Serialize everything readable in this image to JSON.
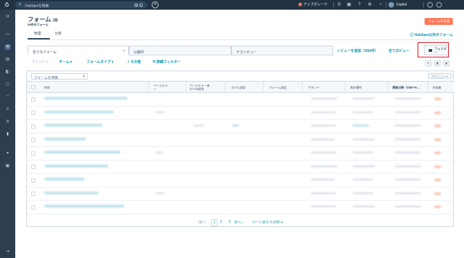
{
  "topbar": {
    "search_placeholder": "HubSpotを検索",
    "kbd1": "⌘",
    "kbd2": "K",
    "add_label": "+",
    "upgrade_label": "アップグレード",
    "copilot_label": "Copilot"
  },
  "page": {
    "title": "フォーム",
    "title_badge": "JB",
    "subtitle": "54件のフォーム",
    "create_button": "フォームを作成",
    "tabs": [
      {
        "label": "管理"
      },
      {
        "label": "分析"
      }
    ],
    "external_link": "HubSpot以外のフォーム"
  },
  "views": {
    "items": [
      {
        "label": "全てのフォーム"
      },
      {
        "label": "公開中"
      },
      {
        "label": "テストビュー"
      }
    ],
    "add_view": "ビューを追加（3/50件）",
    "all_views": "全てのビュー",
    "folder_button": "フォルダ\n―"
  },
  "filters": {
    "brand": "ブランド",
    "team": "チーム",
    "form_type": "フォームタイプ",
    "other": "その他",
    "advanced": "詳細フィルター"
  },
  "table": {
    "search_placeholder": "フォームを検索",
    "actions": "アクション",
    "columns": [
      {
        "label": "名前"
      },
      {
        "label": "ページビュ\n―"
      },
      {
        "label": "ページビューあ\nたりの送信"
      },
      {
        "label": "スパム送信"
      },
      {
        "label": "フォーム送信"
      },
      {
        "label": "ブランド"
      },
      {
        "label": "表示場所"
      },
      {
        "label": "更新日時（GMT+9…"
      },
      {
        "label": "作成者"
      }
    ]
  },
  "pagination": {
    "prev": "前へ",
    "pages": [
      "1",
      "2",
      "3"
    ],
    "next": "次へ",
    "per_page": "ページあたり25件"
  }
}
